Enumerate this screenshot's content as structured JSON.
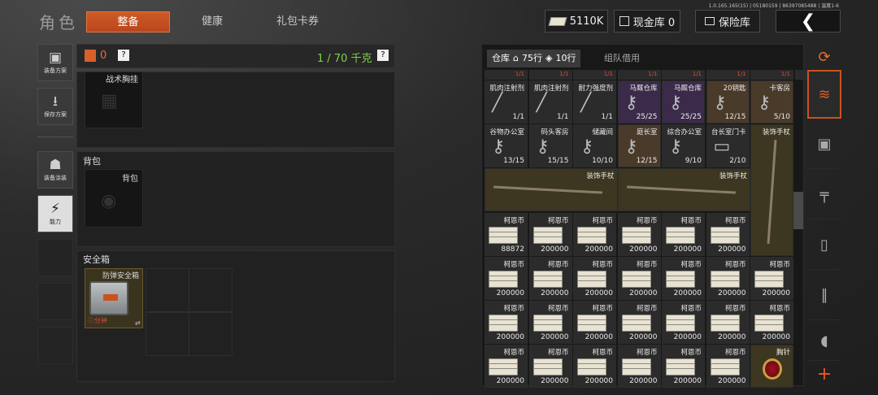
{
  "version": "1.0.165.165(15) | 05180159 | 86397085488 | 温度1-6",
  "title": "角色",
  "tabs": [
    "整备",
    "健康",
    "礼包卡券"
  ],
  "currency": "5110K",
  "gold_vault": "现金库 0",
  "insurance": "保险库",
  "back_icon": "chevron-left",
  "sidebar": [
    "装备方案",
    "保存方案",
    "装备涂装",
    "能力"
  ],
  "equipment": {
    "count": "0",
    "help": "?",
    "weight": "1 / 70 千克",
    "help2": "?",
    "chest_rig": "战术胸挂",
    "backpack_header": "背包",
    "backpack_slot": "背包",
    "safe_header": "安全箱",
    "safe_item": "防弹安全箱",
    "safe_timer": "分钟"
  },
  "warehouse": {
    "tab_label": "仓库",
    "rows_total": "75行",
    "rows_used": "10行",
    "tab2": "组队借用",
    "top_counts": [
      "1/1",
      "1/1",
      "1/1",
      "1/1",
      "1/1",
      "1/1",
      "1/1",
      "1/1"
    ],
    "row1": [
      {
        "name": "肌肉注射剂",
        "count": "1/1"
      },
      {
        "name": "肌肉注射剂",
        "count": "1/1"
      },
      {
        "name": "耐力强度剂",
        "count": "1/1"
      },
      {
        "name": "马厩仓库",
        "count": "25/25"
      },
      {
        "name": "马厩仓库",
        "count": "25/25"
      },
      {
        "name": "20钥匙",
        "count": "12/15"
      },
      {
        "name": "卡客房",
        "count": "5/10"
      }
    ],
    "row2": [
      {
        "name": "谷物办公室",
        "count": "13/15"
      },
      {
        "name": "码头客房",
        "count": "15/15"
      },
      {
        "name": "储藏间",
        "count": "10/10"
      },
      {
        "name": "庭长室",
        "count": "12/15"
      },
      {
        "name": "综合办公室",
        "count": "9/10"
      },
      {
        "name": "台长室门卡",
        "count": "2/10"
      }
    ],
    "cane": "装饰手杖",
    "cash_name": "柯恩币",
    "cash_first": "88872",
    "cash_value": "200000",
    "brooch": "胸针"
  },
  "colors": {
    "accent": "#c9521f",
    "green": "#7cd34a",
    "red": "#e04a3a"
  }
}
